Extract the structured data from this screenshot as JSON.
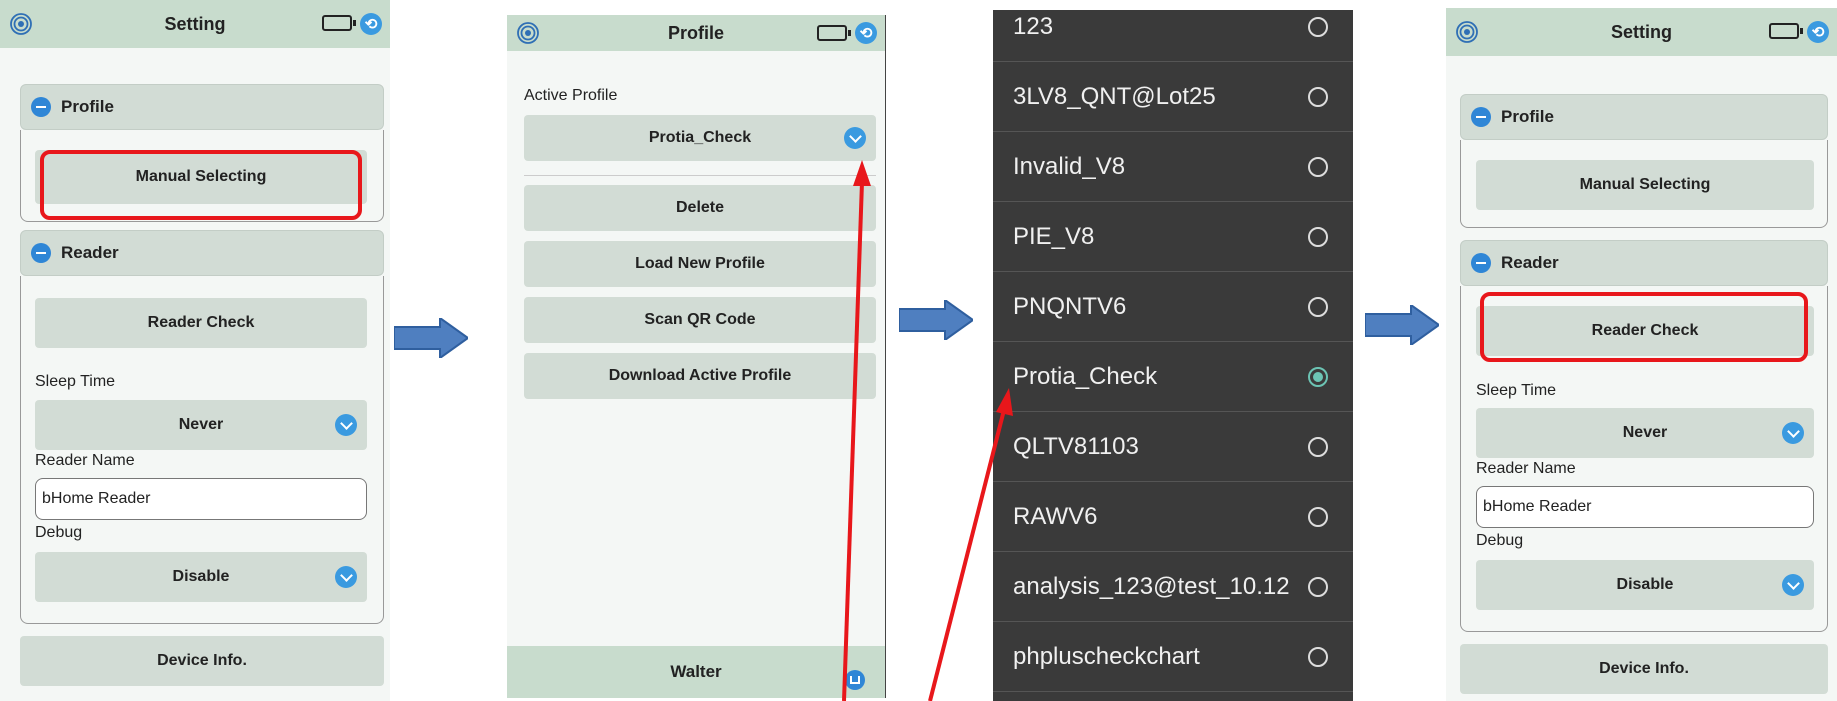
{
  "screen1": {
    "title": "Setting",
    "profile_section": "Profile",
    "manual_selecting": "Manual Selecting",
    "reader_section": "Reader",
    "reader_check": "Reader Check",
    "sleep_time_label": "Sleep Time",
    "sleep_time_value": "Never",
    "reader_name_label": "Reader Name",
    "reader_name_value": "bHome Reader",
    "debug_label": "Debug",
    "debug_value": "Disable",
    "device_info": "Device Info."
  },
  "screen2": {
    "title": "Profile",
    "active_profile_label": "Active Profile",
    "active_profile_value": "Protia_Check",
    "delete": "Delete",
    "load_new_profile": "Load New Profile",
    "scan_qr_code": "Scan QR Code",
    "download_active_profile": "Download Active Profile",
    "footer_user": "Walter"
  },
  "screen3": {
    "options": [
      {
        "label": "123",
        "selected": false
      },
      {
        "label": "3LV8_QNT@Lot25",
        "selected": false
      },
      {
        "label": "Invalid_V8",
        "selected": false
      },
      {
        "label": "PIE_V8",
        "selected": false
      },
      {
        "label": "PNQNTV6",
        "selected": false
      },
      {
        "label": "Protia_Check",
        "selected": true
      },
      {
        "label": "QLTV81103",
        "selected": false
      },
      {
        "label": "RAWV6",
        "selected": false
      },
      {
        "label": "analysis_123@test_10.12",
        "selected": false
      },
      {
        "label": "phpluscheckchart",
        "selected": false
      }
    ]
  },
  "screen4": {
    "title": "Setting",
    "profile_section": "Profile",
    "manual_selecting": "Manual Selecting",
    "reader_section": "Reader",
    "reader_check": "Reader Check",
    "sleep_time_label": "Sleep Time",
    "sleep_time_value": "Never",
    "reader_name_label": "Reader Name",
    "reader_name_value": "bHome Reader",
    "debug_label": "Debug",
    "debug_value": "Disable",
    "device_info": "Device Info."
  },
  "colors": {
    "header_bg": "#c8dccd",
    "button_bg": "#d2dcd5",
    "accent_blue": "#3a9ae0",
    "highlight_red": "#e8171b",
    "flow_arrow": "#4f7fc0",
    "dropdown_bg": "#3a3a3a",
    "radio_selected": "#6cc4b4"
  },
  "icons": [
    "wifi-icon",
    "battery-icon",
    "back-icon",
    "collapse-icon",
    "chevron-down-icon",
    "radio-icon",
    "home-icon",
    "arrow-right-icon"
  ]
}
